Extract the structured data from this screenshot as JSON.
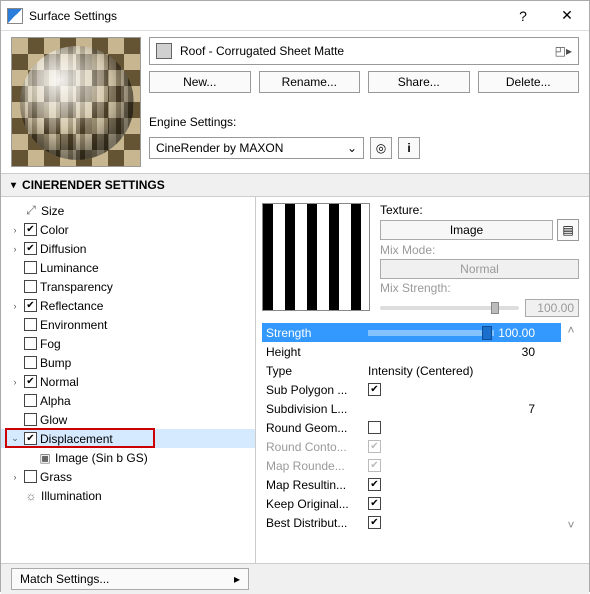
{
  "window": {
    "title": "Surface Settings"
  },
  "material": {
    "name": "Roof - Corrugated Sheet Matte"
  },
  "buttons": {
    "new": "New...",
    "rename": "Rename...",
    "share": "Share...",
    "delete": "Delete..."
  },
  "engine": {
    "label": "Engine Settings:",
    "value": "CineRender by MAXON"
  },
  "section": {
    "cinerender": "CINERENDER SETTINGS"
  },
  "tree": {
    "size": "Size",
    "color": "Color",
    "diffusion": "Diffusion",
    "luminance": "Luminance",
    "transparency": "Transparency",
    "reflectance": "Reflectance",
    "environment": "Environment",
    "fog": "Fog",
    "bump": "Bump",
    "normal": "Normal",
    "alpha": "Alpha",
    "glow": "Glow",
    "displacement": "Displacement",
    "displacement_child": "Image (Sin b GS)",
    "grass": "Grass",
    "illumination": "Illumination"
  },
  "panel": {
    "texture_label": "Texture:",
    "texture_btn": "Image",
    "mixmode_label": "Mix Mode:",
    "mixmode_btn": "Normal",
    "mixstrength_label": "Mix Strength:",
    "mixstrength_val": "100.00",
    "props": {
      "strength": "Strength",
      "strength_val": "100.00",
      "height": "Height",
      "height_val": "30",
      "type": "Type",
      "type_val": "Intensity (Centered)",
      "subpoly": "Sub Polygon ...",
      "subdiv": "Subdivision L...",
      "subdiv_val": "7",
      "roundgeom": "Round Geom...",
      "roundcont": "Round Conto...",
      "mapround": "Map Rounde...",
      "mapresult": "Map Resultin...",
      "keeporig": "Keep Original...",
      "bestdist": "Best Distribut..."
    }
  },
  "footer": {
    "match": "Match Settings..."
  }
}
